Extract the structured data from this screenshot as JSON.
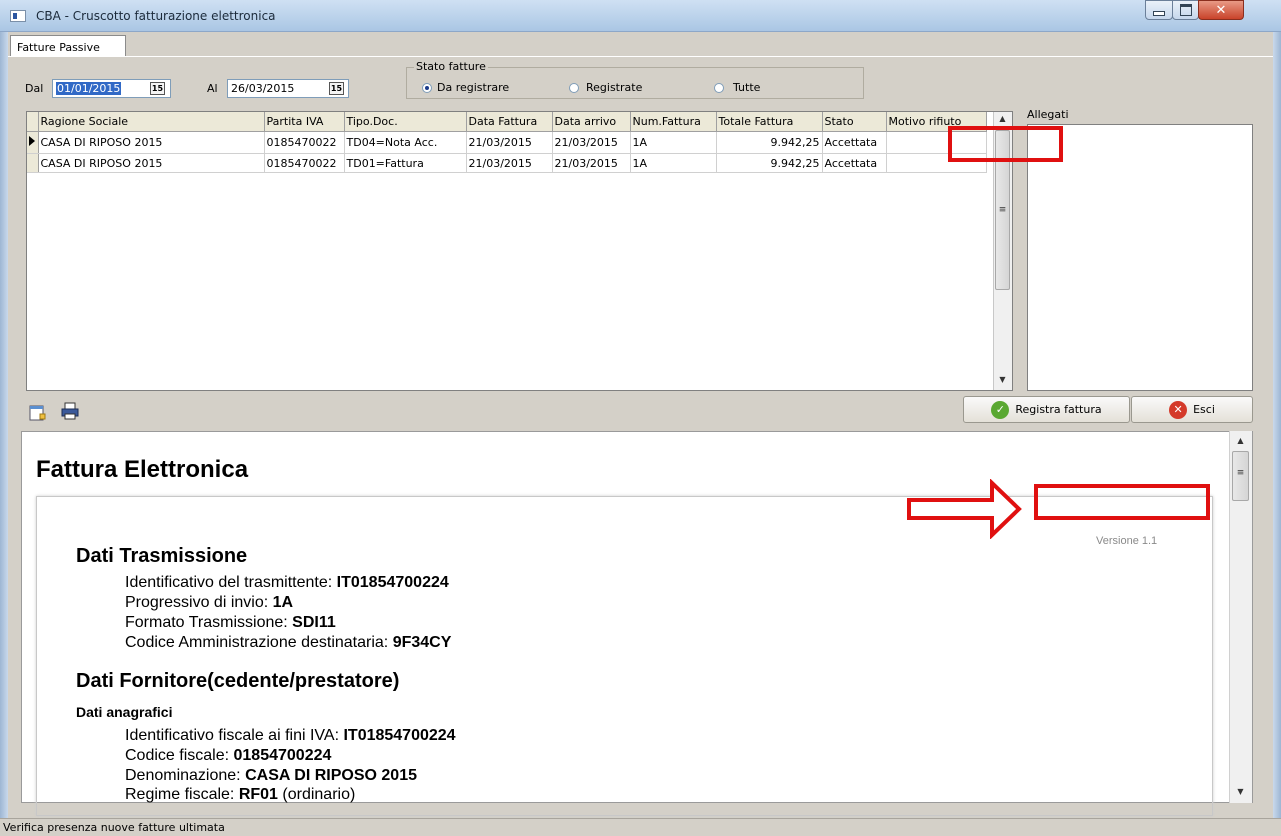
{
  "window": {
    "title": "CBA - Cruscotto fatturazione elettronica"
  },
  "tabs": [
    {
      "label": "Fatture Passive"
    }
  ],
  "filter": {
    "dal_label": "Dal",
    "dal_value": "01/01/2015",
    "al_label": "Al",
    "al_value": "26/03/2015",
    "calendar_glyph": "15",
    "stato_label": "Stato fatture",
    "options": [
      "Da registrare",
      "Registrate",
      "Tutte"
    ],
    "selected": "Da registrare"
  },
  "grid": {
    "columns": [
      "Ragione Sociale",
      "Partita IVA",
      "Tipo.Doc.",
      "Data Fattura",
      "Data arrivo",
      "Num.Fattura",
      "Totale Fattura",
      "Stato",
      "Motivo rifiuto"
    ],
    "rows": [
      [
        "CASA DI RIPOSO 2015",
        "0185470022",
        "TD04=Nota Acc.",
        "21/03/2015",
        "21/03/2015",
        "1A",
        "9.942,25",
        "Accettata",
        ""
      ],
      [
        "CASA DI RIPOSO 2015",
        "0185470022",
        "TD01=Fattura",
        "21/03/2015",
        "21/03/2015",
        "1A",
        "9.942,25",
        "Accettata",
        ""
      ]
    ]
  },
  "allegati": {
    "label": "Allegati"
  },
  "toolbar": {
    "registra_label": "Registra fattura",
    "esci_label": "Esci"
  },
  "document": {
    "title": "Fattura Elettronica",
    "version": "Versione 1.1",
    "sections": {
      "trasmissione": {
        "heading": "Dati Trasmissione",
        "id_label": "Identificativo del trasmittente: ",
        "id_value": "IT01854700224",
        "prog_label": "Progressivo di invio: ",
        "prog_value": "1A",
        "formato_label": "Formato Trasmissione: ",
        "formato_value": "SDI11",
        "codice_label": "Codice Amministrazione destinataria: ",
        "codice_value": "9F34CY"
      },
      "fornitore": {
        "heading": "Dati Fornitore(cedente/prestatore)",
        "subheading": "Dati anagrafici",
        "iva_label": "Identificativo fiscale ai fini IVA: ",
        "iva_value": "IT01854700224",
        "cf_label": "Codice fiscale: ",
        "cf_value": "01854700224",
        "den_label": "Denominazione: ",
        "den_value": "CASA DI RIPOSO 2015",
        "regime_label": "Regime fiscale: ",
        "regime_value": "RF01",
        "regime_note": " (ordinario)"
      }
    }
  },
  "status": {
    "text": "Verifica presenza nuove fatture ultimata"
  },
  "colors": {
    "annotation_red": "#e01010",
    "selection_blue": "#3169c6",
    "accept_green": "#5aa832",
    "exit_red": "#d43a2a"
  }
}
